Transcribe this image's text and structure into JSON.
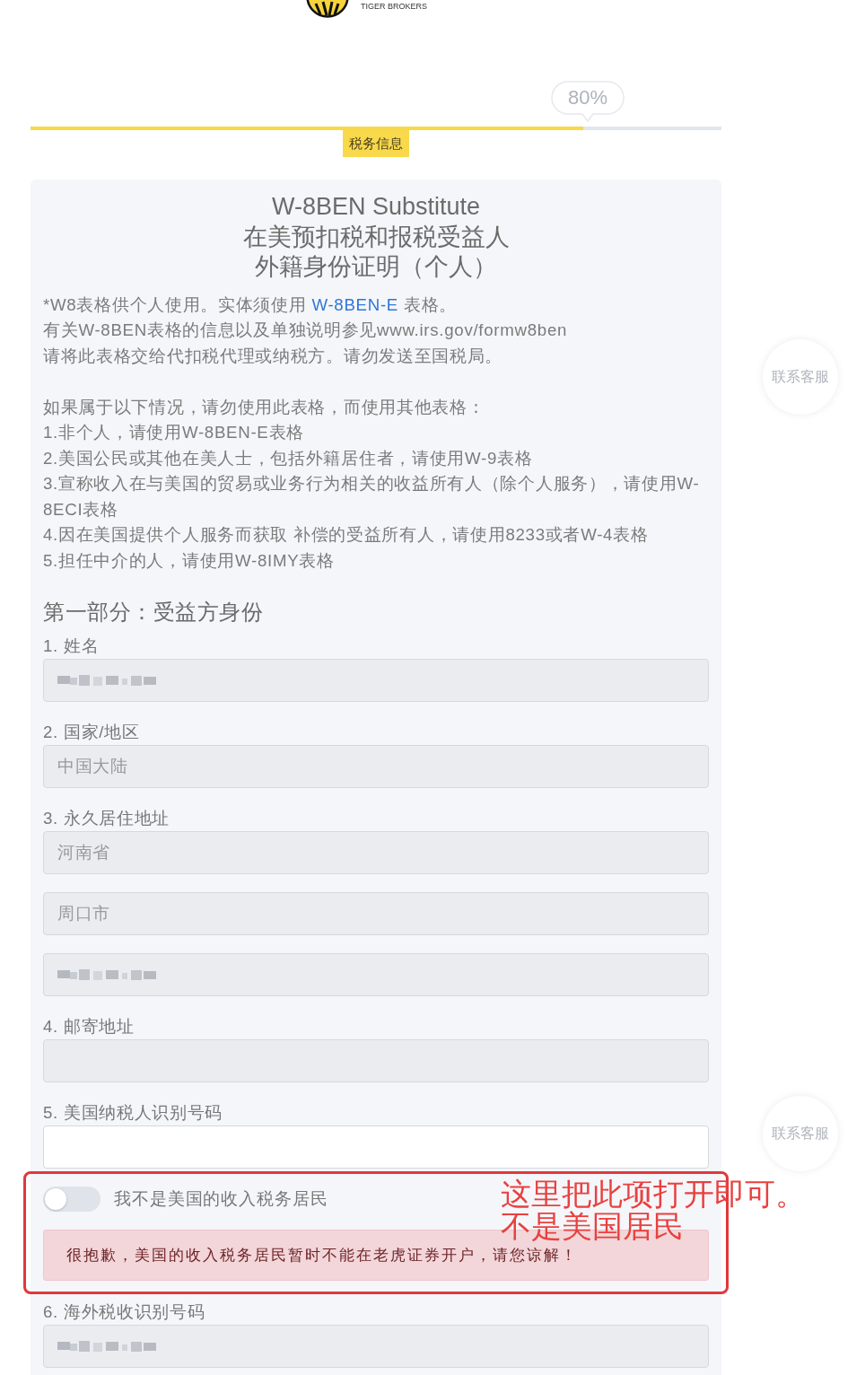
{
  "logo": {
    "subtitle": "TIGER BROKERS"
  },
  "progress": {
    "level": 0.8,
    "reading": "80%",
    "step": "税务信息"
  },
  "form": {
    "title_lines": [
      "W-8BEN Substitute",
      "在美预扣税和报税受益人",
      "外籍身份证明（个人）"
    ],
    "notes": [
      {
        "text": "*W8表格供个人使用。实体须使用 ",
        "link": "W-8BEN-E",
        "text_after": " 表格。"
      },
      {
        "text": "有关W-8BEN表格的信息以及单独说明参见www.irs.gov/formw8ben"
      },
      {
        "text": "请将此表格交给代扣税代理或纳税方。请勿发送至国税局。"
      }
    ],
    "exclusions_intro": "如果属于以下情况，请勿使用此表格，而使用其他表格：",
    "exclusions": [
      "1.非个人，请使用W-8BEN-E表格",
      "2.美国公民或其他在美人士，包括外籍居住者，请使用W-9表格",
      "3.宣称收入在与美国的贸易或业务行为相关的收益所有人（除个人服务），请使用W-8ECI表格",
      "4.因在美国提供个人服务而获取 补偿的受益所有人，请使用8233或者W-4表格",
      "5.担任中介的人，请使用W-8IMY表格"
    ],
    "section_title": "第一部分：受益方身份",
    "fields": [
      {
        "label": "1. 姓名",
        "inputs": [
          {
            "disabled": true,
            "redacted": true
          }
        ]
      },
      {
        "label": "2. 国家/地区",
        "inputs": [
          {
            "disabled": true,
            "redacted": false,
            "value": "中国大陆"
          }
        ]
      },
      {
        "label": "3. 永久居住地址",
        "inputs": [
          {
            "disabled": true,
            "redacted": false,
            "value": "河南省"
          },
          {
            "disabled": true,
            "redacted": false,
            "value": "周口市"
          },
          {
            "disabled": true,
            "redacted": true
          }
        ]
      },
      {
        "label": "4. 邮寄地址",
        "inputs": [
          {
            "disabled": true,
            "redacted": false
          }
        ]
      },
      {
        "label": "5. 美国纳税人识别号码",
        "inputs": [
          {
            "disabled": false,
            "redacted": false
          }
        ]
      }
    ],
    "residency": {
      "toggle": {
        "label": "我不是美国的收入税务居民",
        "on": false
      },
      "alert": "很抱歉，美国的收入税务居民暂时不能在老虎证券开户，请您谅解！"
    },
    "fields_after": [
      {
        "label": "6. 海外税收识别号码",
        "inputs": [
          {
            "disabled": true,
            "redacted": true
          }
        ]
      }
    ]
  },
  "annotation": {
    "lines": [
      "这里把此项打开即可。",
      "不是美国居民"
    ]
  },
  "help_buttons": [
    {
      "label": "联系客服"
    },
    {
      "label": "联系客服"
    }
  ]
}
